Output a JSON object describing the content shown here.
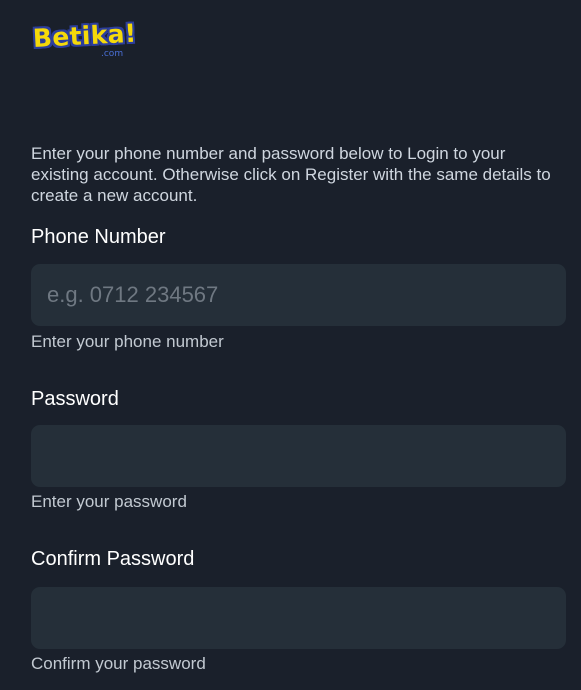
{
  "brand": {
    "name": "Betika!",
    "domain_suffix": ".com",
    "colors": {
      "background": "#1a202b",
      "input_background": "#252f39",
      "logo_yellow": "#f5d90a",
      "logo_blue": "#2c3e9c"
    }
  },
  "form": {
    "intro": "Enter your phone number and password below to Login to your existing account. Otherwise click on Register with the same details to create a new account.",
    "phone": {
      "label": "Phone Number",
      "placeholder": "e.g. 0712 234567",
      "value": "",
      "hint": "Enter your phone number"
    },
    "password": {
      "label": "Password",
      "placeholder": "",
      "value": "",
      "hint": "Enter your password"
    },
    "confirm_password": {
      "label": "Confirm Password",
      "placeholder": "",
      "value": "",
      "hint": "Confirm your password"
    }
  }
}
